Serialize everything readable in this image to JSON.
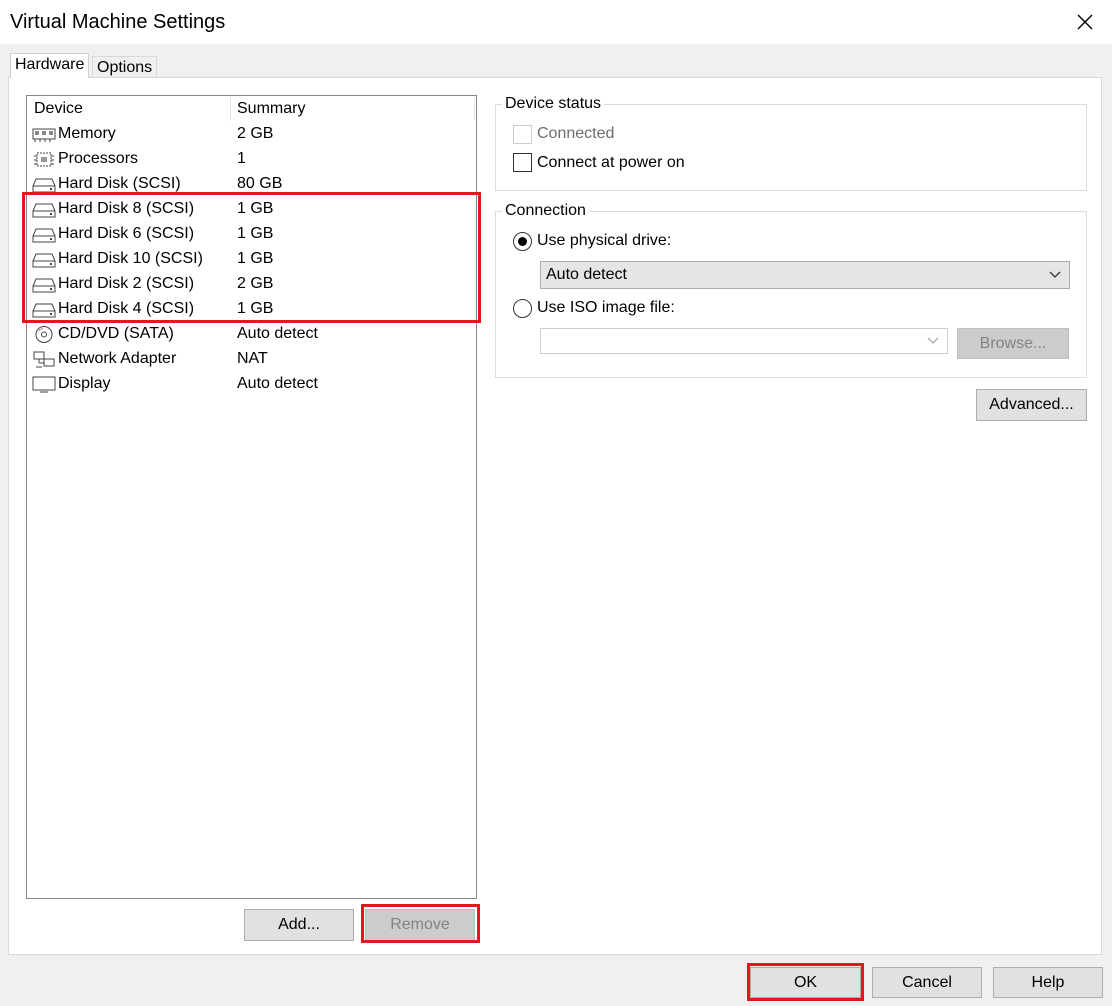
{
  "window": {
    "title": "Virtual Machine Settings"
  },
  "tabs": [
    {
      "label": "Hardware"
    },
    {
      "label": "Options"
    }
  ],
  "device_list": {
    "columns": {
      "device": "Device",
      "summary": "Summary"
    },
    "rows": [
      {
        "name": "Memory",
        "summary": "2 GB",
        "icon": "memory-icon"
      },
      {
        "name": "Processors",
        "summary": "1",
        "icon": "processor-icon"
      },
      {
        "name": "Hard Disk (SCSI)",
        "summary": "80 GB",
        "icon": "hard-disk-icon"
      },
      {
        "name": "Hard Disk 8 (SCSI)",
        "summary": "1 GB",
        "icon": "hard-disk-icon"
      },
      {
        "name": "Hard Disk 6 (SCSI)",
        "summary": "1 GB",
        "icon": "hard-disk-icon"
      },
      {
        "name": "Hard Disk 10 (SCSI)",
        "summary": "1 GB",
        "icon": "hard-disk-icon"
      },
      {
        "name": "Hard Disk 2 (SCSI)",
        "summary": "2 GB",
        "icon": "hard-disk-icon"
      },
      {
        "name": "Hard Disk 4 (SCSI)",
        "summary": "1 GB",
        "icon": "hard-disk-icon"
      },
      {
        "name": "CD/DVD (SATA)",
        "summary": "Auto detect",
        "icon": "cd-dvd-icon"
      },
      {
        "name": "Network Adapter",
        "summary": "NAT",
        "icon": "network-adapter-icon"
      },
      {
        "name": "Display",
        "summary": "Auto detect",
        "icon": "display-icon"
      }
    ]
  },
  "list_buttons": {
    "add": "Add...",
    "remove": "Remove"
  },
  "device_status": {
    "title": "Device status",
    "connected": "Connected",
    "connect_at_power_on": "Connect at power on"
  },
  "connection": {
    "title": "Connection",
    "use_physical_drive": "Use physical drive:",
    "physical_drive_value": "Auto detect",
    "use_iso_image": "Use ISO image file:",
    "iso_value": "",
    "browse": "Browse..."
  },
  "advanced": "Advanced...",
  "footer": {
    "ok": "OK",
    "cancel": "Cancel",
    "help": "Help"
  },
  "colors": {
    "highlight": "#e4161e",
    "dialog_bg": "#f0f0f0",
    "button_bg": "#e1e1e1"
  }
}
